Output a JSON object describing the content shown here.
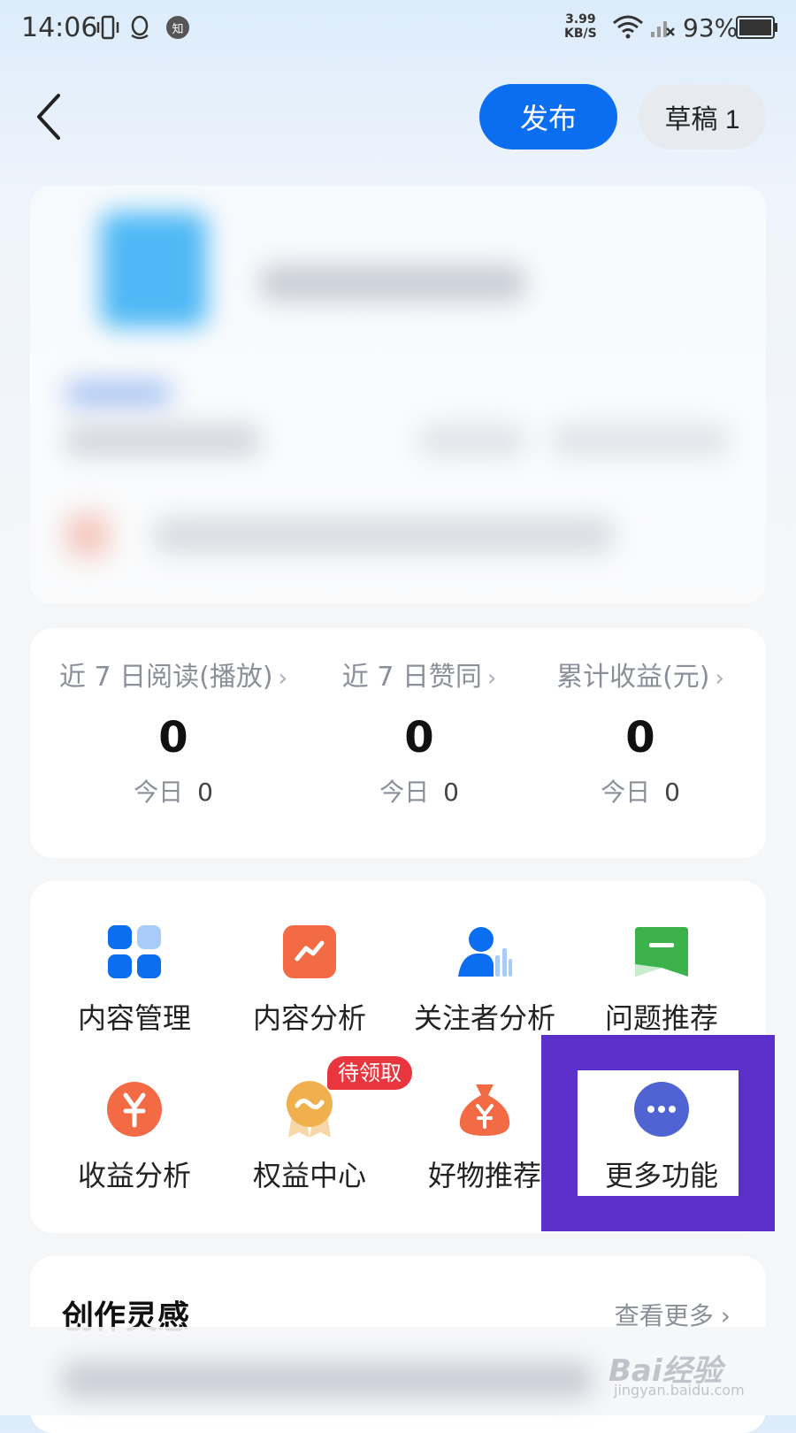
{
  "status_bar": {
    "time": "14:06",
    "network_speed_value": "3.99",
    "network_speed_unit": "KB/S",
    "battery_percent": "93%",
    "zhihu_badge": "知"
  },
  "header": {
    "publish_label": "发布",
    "draft_label": "草稿 1"
  },
  "stats": [
    {
      "label": "近 7 日阅读(播放)",
      "value": "0",
      "today_label": "今日",
      "today_value": "0"
    },
    {
      "label": "近 7 日赞同",
      "value": "0",
      "today_label": "今日",
      "today_value": "0"
    },
    {
      "label": "累计收益(元)",
      "value": "0",
      "today_label": "今日",
      "today_value": "0"
    }
  ],
  "functions": [
    {
      "label": "内容管理",
      "icon": "grid-icon",
      "color": "#0b6df0"
    },
    {
      "label": "内容分析",
      "icon": "trend-chart-icon",
      "color": "#f36b45"
    },
    {
      "label": "关注者分析",
      "icon": "follower-stats-icon",
      "color": "#0b6df0"
    },
    {
      "label": "问题推荐",
      "icon": "question-flag-icon",
      "color": "#3cb34a"
    },
    {
      "label": "收益分析",
      "icon": "yuan-coin-icon",
      "color": "#f36b45"
    },
    {
      "label": "权益中心",
      "icon": "medal-icon",
      "color": "#f0b04e"
    },
    {
      "label": "好物推荐",
      "icon": "money-bag-icon",
      "color": "#f36b45"
    },
    {
      "label": "更多功能",
      "icon": "more-dots-icon",
      "color": "#4f63d2"
    }
  ],
  "rights_badge": "待领取",
  "inspiration": {
    "title": "创作灵感",
    "see_more": "查看更多"
  },
  "watermark": {
    "main": "Bai经验",
    "sub": "jingyan.baidu.com"
  },
  "colors": {
    "accent": "#0b6df0",
    "highlight": "#5b2fc9",
    "badge": "#e8353e"
  }
}
